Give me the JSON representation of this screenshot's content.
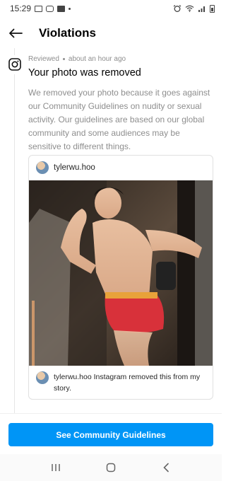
{
  "status_bar": {
    "time": "15:29"
  },
  "header": {
    "title": "Violations"
  },
  "notice": {
    "status": "Reviewed",
    "timestamp": "about an hour ago",
    "title": "Your photo was removed",
    "body": "We removed your photo because it goes against our Community Guidelines on nudity or sexual activity. Our guidelines are based on our global community and some audiences may be sensitive to different things."
  },
  "post": {
    "username": "tylerwu.hoo",
    "caption": "tylerwu.hoo Instagram removed this from my story."
  },
  "cta": {
    "label": "See Community Guidelines"
  },
  "colors": {
    "accent": "#0095f6",
    "text_primary": "#262626",
    "text_secondary": "#8e8e8e"
  },
  "icons": [
    "back-arrow-icon",
    "instagram-icon",
    "nav-recents-icon",
    "nav-home-icon",
    "nav-back-icon"
  ]
}
